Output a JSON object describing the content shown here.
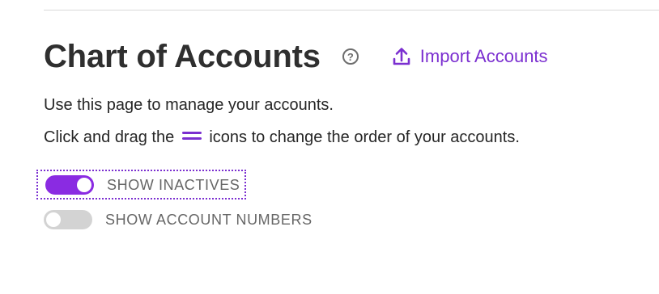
{
  "header": {
    "title": "Chart of Accounts",
    "help_icon_glyph": "?",
    "import_label": "Import Accounts",
    "import_icon": "upload-icon",
    "accent_color": "#7b2fd0"
  },
  "description": {
    "line1": "Use this page to manage your accounts.",
    "line2_before": "Click and drag the",
    "line2_icon": "drag-handle-icon",
    "line2_after": "icons to change the order of your accounts."
  },
  "toggles": [
    {
      "label": "SHOW INACTIVES",
      "state": "on",
      "focused": true
    },
    {
      "label": "SHOW ACCOUNT NUMBERS",
      "state": "off",
      "focused": false
    }
  ]
}
